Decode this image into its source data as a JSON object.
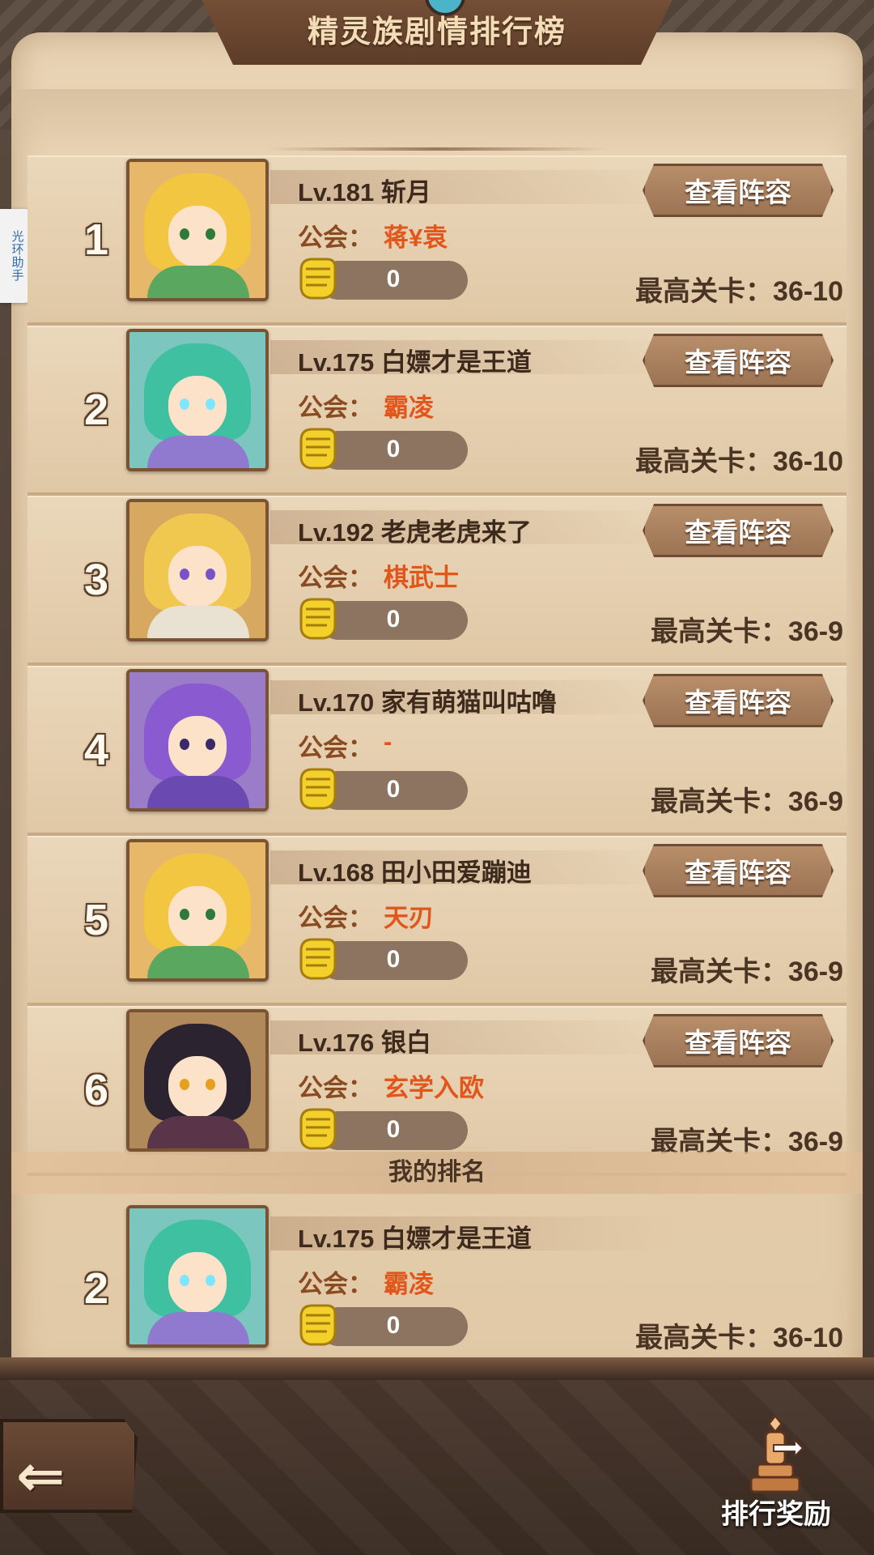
{
  "header": {
    "title": "精灵族剧情排行榜"
  },
  "helper_tab": {
    "label": "光环助手"
  },
  "labels": {
    "guild_prefix": "公会：",
    "stage_prefix": "最高关卡：",
    "view_lineup": "查看阵容",
    "my_rank": "我的排名",
    "reward": "排行奖励"
  },
  "rows": [
    {
      "rank": "1",
      "name": "Lv.181 斩月",
      "guild": "蒋¥袁",
      "likes": "0",
      "stage": "最高关卡：36-10",
      "hero": "blonde-elf"
    },
    {
      "rank": "2",
      "name": "Lv.175 白嫖才是王道",
      "guild": "霸凌",
      "likes": "0",
      "stage": "最高关卡：36-10",
      "hero": "teal-visor"
    },
    {
      "rank": "3",
      "name": "Lv.192 老虎老虎来了",
      "guild": "棋武士",
      "likes": "0",
      "stage": "最高关卡：36-9",
      "hero": "golden-knight"
    },
    {
      "rank": "4",
      "name": "Lv.170 家有萌猫叫咕噜",
      "guild": "-",
      "likes": "0",
      "stage": "最高关卡：36-9",
      "hero": "purple-harpist"
    },
    {
      "rank": "5",
      "name": "Lv.168 田小田爱蹦迪",
      "guild": "天刃",
      "likes": "0",
      "stage": "最高关卡：36-9",
      "hero": "blonde-elf"
    },
    {
      "rank": "6",
      "name": "Lv.176 银白",
      "guild": "玄学入欧",
      "likes": "0",
      "stage": "最高关卡：36-9",
      "hero": "dark-warrior"
    }
  ],
  "my_row": {
    "rank": "2",
    "name": "Lv.175 白嫖才是王道",
    "guild": "霸凌",
    "likes": "0",
    "stage": "最高关卡：36-10",
    "hero": "teal-visor"
  },
  "colors": {
    "parchment": "#e8d3b4",
    "guild_name": "#e2561b",
    "button": "#a98262"
  }
}
